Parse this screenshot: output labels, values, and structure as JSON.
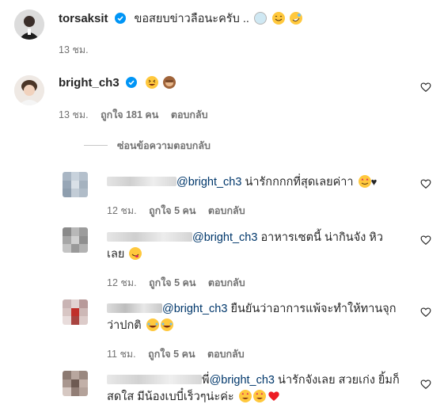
{
  "post": {
    "username": "torsaksit",
    "caption": "ขอสยบข่าวลือนะครับ ..",
    "time": "13 ชม."
  },
  "comment": {
    "username": "bright_ch3",
    "time": "13 ชม.",
    "likes": "ถูกใจ 181 คน",
    "reply": "ตอบกลับ",
    "hide_replies": "ซ่อนข้อความตอบกลับ"
  },
  "replies": [
    {
      "mention": "@bright_ch3",
      "text": " น่ารักกกกที่สุดเลยค่าา",
      "time": "12 ชม.",
      "likes": "ถูกใจ 5 คน",
      "reply": "ตอบกลับ"
    },
    {
      "mention": "@bright_ch3",
      "text": " อาหารเซตนี้ น่ากินจัง หิว",
      "text2": "เลย",
      "time": "12 ชม.",
      "likes": "ถูกใจ 5 คน",
      "reply": "ตอบกลับ"
    },
    {
      "mention": "@bright_ch3",
      "text": " ยืนยันว่าอาการแพ้จะทำให้ทานจุก",
      "text2": "ว่าปกติ",
      "time": "11 ชม.",
      "likes": "ถูกใจ 5 คน",
      "reply": "ตอบกลับ"
    },
    {
      "prefix": "พี่",
      "mention": "@bright_ch3",
      "text": " น่ารักจังเลย สวยเก่ง ยิ้มก็",
      "text2": "สดใส มีน้องเบบี๋เร็วๆน่ะค่ะ"
    }
  ],
  "icons": {
    "verified": "verified-badge-icon",
    "like": "heart-outline-icon"
  },
  "colors": {
    "verified": "#0095f6",
    "mention": "#00376b",
    "meta": "#737373",
    "heart_red": "#ed1c24"
  }
}
